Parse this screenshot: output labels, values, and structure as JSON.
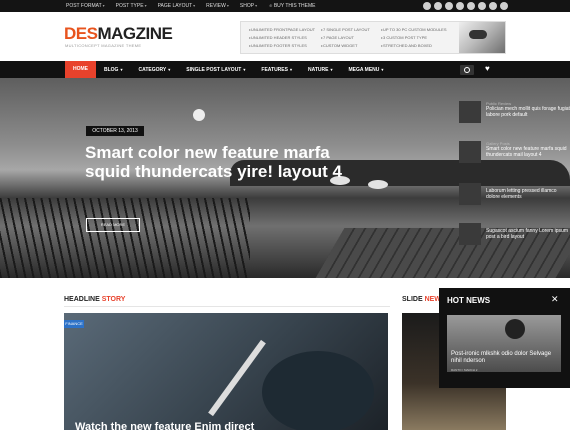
{
  "topbar": {
    "menu": [
      {
        "label": "POST FORMAT"
      },
      {
        "label": "POST TYPE"
      },
      {
        "label": "PAGE LAYOUT"
      },
      {
        "label": "REVIEW"
      },
      {
        "label": "SHOP"
      },
      {
        "label": "BUY THIS THEME"
      }
    ],
    "social_icons": [
      "google-plus-icon",
      "dribbble-icon",
      "skype-icon",
      "twitter-icon",
      "vimeo-icon",
      "skype-alt-icon",
      "facebook-icon",
      "rss-icon"
    ]
  },
  "header": {
    "logo_prefix": "DES",
    "logo_rest": "MAGZINE",
    "tagline": "MULTICONCEPT MAGAZINE THEME",
    "ad": {
      "col1": [
        "UNLIMITED FRONTPAGE LAYOUT",
        "UNLIMITED HEADER STYLES",
        "UNLIMITED FOOTER STYLES"
      ],
      "col2": [
        "7 SINGLE POST LAYOUT",
        "7 PAGE LAYOUT",
        "CUSTOM WIDGET"
      ],
      "col3": [
        "UP TO 30 PC CUSTOM MODULES",
        "3 CUSTOM POST TYPE",
        "STRETCHED AND BOXED"
      ]
    }
  },
  "nav": {
    "items": [
      {
        "label": "HOME"
      },
      {
        "label": "BLOG"
      },
      {
        "label": "CATEGORY"
      },
      {
        "label": "SINGLE POST LAYOUT"
      },
      {
        "label": "FEATURES"
      },
      {
        "label": "NATURE"
      },
      {
        "label": "MEGA MENU"
      }
    ]
  },
  "hero": {
    "date": "OCTOBER 13, 2013",
    "title": "Smart color new feature marfa squid thundercats yire! layout 4",
    "read_more": "READ MORE",
    "side_list": [
      {
        "category": "Public Review",
        "text": "Polician mech mollit quis forage fugiat labore pork default"
      },
      {
        "category": "Gallery Posts",
        "text": "Smart color new feature marfa squid thundercats mail layout 4"
      },
      {
        "category": "",
        "text": "Laborum letting pressed illamco dolore elements"
      },
      {
        "category": "",
        "text": "Sugascot ascium fanny Lorem ipsum post a bird layout"
      }
    ]
  },
  "headline": {
    "title_a": "HEADLINE",
    "title_b": "STORY",
    "tag": "FINANCE",
    "post_title": "Watch the new feature Enim direct"
  },
  "slide": {
    "title_a": "SLIDE",
    "title_b": "NEWS"
  },
  "hotnews": {
    "title": "HOT NEWS",
    "close": "✕",
    "text": "Post-ironic mlkshk odio dolor Selvage nihil nderson",
    "meta": "RANTO / MARCH 2"
  },
  "colors": {
    "accent": "#e8422c",
    "logo_accent": "#e8541e",
    "finance": "#2d72c8"
  }
}
